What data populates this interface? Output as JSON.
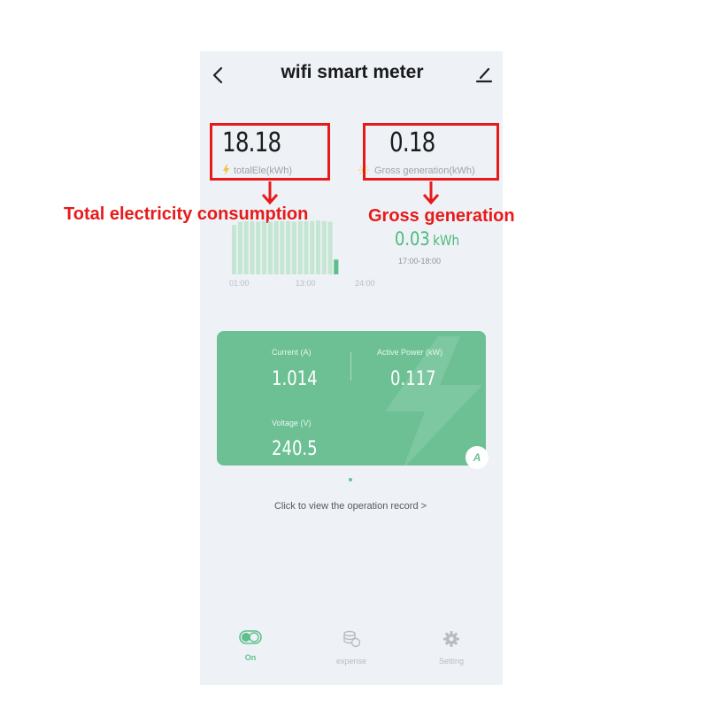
{
  "header": {
    "title": "wifi smart meter"
  },
  "stats": {
    "total": {
      "value": "18.18",
      "label": "totalEle(kWh)"
    },
    "gross": {
      "value": "0.18",
      "label": "Gross generation(kWh)"
    }
  },
  "annotations": {
    "total": "Total electricity consumption",
    "gross": "Gross generation"
  },
  "chart": {
    "ticks": [
      "01:00",
      "13:00",
      "24:00"
    ],
    "generation_value": "0.03",
    "generation_unit": "kWh",
    "generation_time": "17:00-18:00"
  },
  "chart_data": {
    "type": "bar",
    "x": [
      "01:00",
      "02:00",
      "03:00",
      "04:00",
      "05:00",
      "06:00",
      "07:00",
      "08:00",
      "09:00",
      "10:00",
      "11:00",
      "12:00",
      "13:00",
      "14:00",
      "15:00",
      "16:00",
      "17:00",
      "18:00"
    ],
    "values": [
      0.9,
      0.96,
      0.97,
      0.97,
      0.96,
      0.97,
      0.96,
      0.97,
      0.97,
      0.97,
      0.96,
      0.97,
      0.97,
      0.97,
      0.98,
      0.97,
      0.96,
      0.27
    ],
    "highlight_index": 17,
    "colors": {
      "normal": "#c5e6d3",
      "highlight": "#5fbf8c"
    },
    "ylim": [
      0,
      1
    ]
  },
  "metrics": {
    "current": {
      "label": "Current (A)",
      "value": "1.014"
    },
    "power": {
      "label": "Active Power (kW)",
      "value": "0.117"
    },
    "voltage": {
      "label": "Voltage (V)",
      "value": "240.5"
    },
    "badge": "A"
  },
  "operation_record": "Click to view the operation record >",
  "tabs": [
    {
      "label": "On",
      "icon": "toggle-icon",
      "active": true
    },
    {
      "label": "expense",
      "icon": "coins-icon",
      "active": false
    },
    {
      "label": "Setting",
      "icon": "gear-icon",
      "active": false
    }
  ],
  "colors": {
    "accent": "#6cc094",
    "annotation_red": "#e61a1a"
  }
}
